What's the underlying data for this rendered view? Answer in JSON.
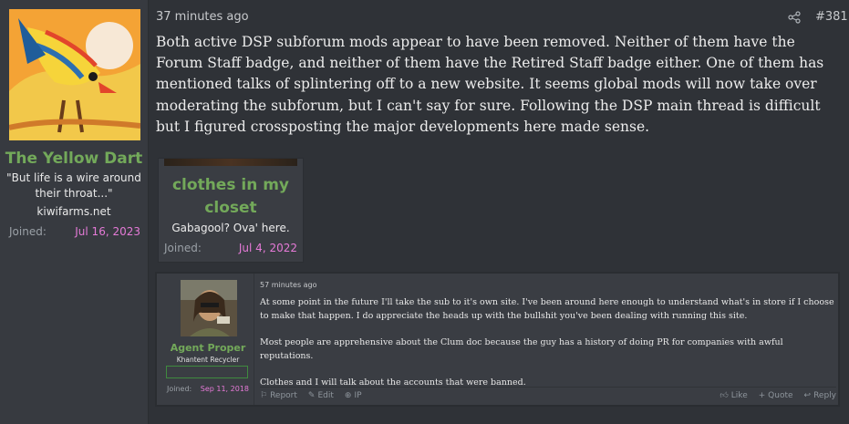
{
  "user": {
    "name": "The Yellow Dart",
    "title": "\"But life is a wire around their throat...\"",
    "site": "kiwifarms.net",
    "joined_label": "Joined:",
    "joined_date": "Jul 16, 2023"
  },
  "post": {
    "time": "37 minutes ago",
    "number": "#381",
    "body": "Both active DSP subforum mods appear to have been removed. Neither of them have the Forum Staff badge, and neither of them have the Retired Staff badge either. One of them has mentioned talks of splintering off to a new website. It seems global mods will now take over moderating the subforum, but I can't say for sure. Following the DSP main thread is difficult but I figured crossposting the major developments here made sense."
  },
  "card": {
    "name": "clothes in my closet",
    "title": "Gabagool? Ova' here.",
    "joined_label": "Joined:",
    "joined_date": "Jul 4, 2022"
  },
  "reply": {
    "user_name": "Agent Proper",
    "user_rank": "Khantent Recycler",
    "badge": "",
    "joined_label": "Joined:",
    "joined_date": "Sep 11, 2018",
    "time": "57 minutes ago",
    "paragraphs": [
      "At some point in the future I'll take the sub to it's own site. I've been around here enough to understand what's in store if I choose to make that happen. I do appreciate the heads up with the bullshit you've been dealing with running this site.",
      "Most people are apprehensive about the Clum doc because the guy has a history of doing PR for companies with awful reputations.",
      "Clothes and I will talk about the accounts that were banned."
    ],
    "actions": {
      "report": "Report",
      "edit": "Edit",
      "ip": "IP",
      "like": "Like",
      "quote": "+ Quote",
      "reply": "Reply"
    }
  },
  "icons": {
    "share": "share-icon",
    "report": "flag-icon",
    "edit": "pencil-icon",
    "ip": "globe-icon",
    "like": "thumbs-up-icon",
    "reply": "reply-arrow-icon"
  },
  "colors": {
    "username": "#73a95a",
    "date": "#e57ad7",
    "background": "#2f3237"
  }
}
